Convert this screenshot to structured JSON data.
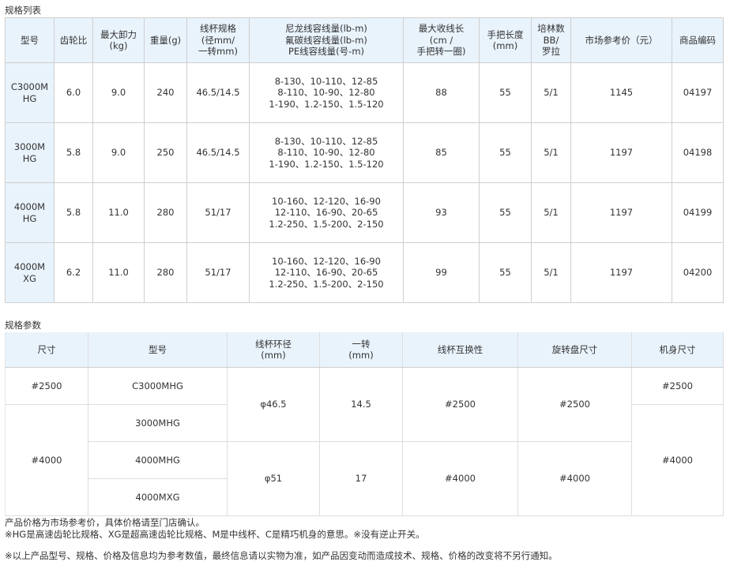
{
  "spec_table": {
    "title": "规格列表",
    "headers": [
      "型号",
      "齿轮比",
      "最大卸力\n(kg)",
      "重量(g)",
      "线杯规格\n(径mm/\n一转mm)",
      "尼龙线容线量(lb-m)\n氟碳线容线量(lb-m)\nPE线容线量(号-m)",
      "最大收线长\n(cm /\n手把转一圈)",
      "手把长度\n(mm)",
      "培林数\nBB/\n罗拉",
      "市场参考价（元）",
      "商品编码"
    ],
    "rows": [
      [
        "C3000M\nHG",
        "6.0",
        "9.0",
        "240",
        "46.5/14.5",
        "8-130、10-110、12-85\n8-110、10-90、12-80\n1-190、1.2-150、1.5-120",
        "88",
        "55",
        "5/1",
        "1145",
        "04197"
      ],
      [
        "3000M\nHG",
        "5.8",
        "9.0",
        "250",
        "46.5/14.5",
        "8-130、10-110、12-85\n8-110、10-90、12-80\n1-190、1.2-150、1.5-120",
        "85",
        "55",
        "5/1",
        "1197",
        "04198"
      ],
      [
        "4000M\nHG",
        "5.8",
        "11.0",
        "280",
        "51/17",
        "10-160、12-120、16-90\n12-110、16-90、20-65\n1.2-250、1.5-200、2-150",
        "93",
        "55",
        "5/1",
        "1197",
        "04199"
      ],
      [
        "4000M\nXG",
        "6.2",
        "11.0",
        "280",
        "51/17",
        "10-160、12-120、16-90\n12-110、16-90、20-65\n1.2-250、1.5-200、2-150",
        "99",
        "55",
        "5/1",
        "1197",
        "04200"
      ]
    ]
  },
  "param_table": {
    "title": "规格参数",
    "headers": [
      "尺寸",
      "型号",
      "线杯环径\n(mm)",
      "一转\n(mm)",
      "线杯互换性",
      "旋转盘尺寸",
      "机身尺寸"
    ],
    "size_2500": "#2500",
    "size_4000": "#4000",
    "models": [
      "C3000MHG",
      "3000MHG",
      "4000MHG",
      "4000MXG"
    ],
    "spool_dia_1": "φ46.5",
    "spool_dia_2": "φ51",
    "per_turn_1": "14.5",
    "per_turn_2": "17",
    "spool_compat_1": "#2500",
    "spool_compat_2": "#4000",
    "rotor_1": "#2500",
    "rotor_2": "#4000",
    "body_1": "#2500",
    "body_2": "#4000"
  },
  "notes": [
    "产品价格为市场参考价，具体价格请至门店确认。",
    "※HG是高速齿轮比规格、XG是超高速齿轮比规格、M是中线杯、C是精巧机身的意思。※没有逆止开关。",
    "※以上产品型号、规格、价格及信息均为参考数值，最终信息请以实物为准，如产品因变动而造成技术、规格、价格的改变将不另行通知。"
  ],
  "colors": {
    "header_bg": "#e9f3fc",
    "border": "#cfcfcf",
    "text": "#333333"
  }
}
